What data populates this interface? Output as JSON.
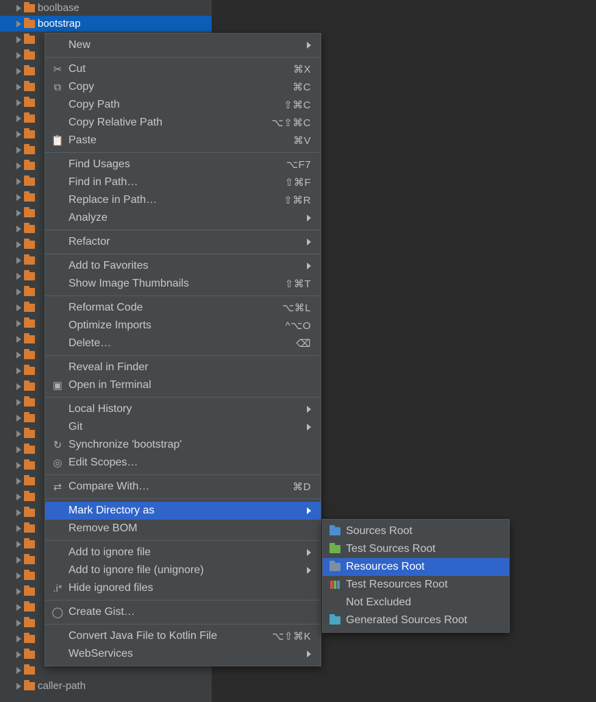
{
  "tree": {
    "items": [
      {
        "label": "boolbase",
        "selected": false
      },
      {
        "label": "bootstrap",
        "selected": true
      },
      {
        "label": "",
        "selected": false
      },
      {
        "label": "",
        "selected": false
      },
      {
        "label": "",
        "selected": false
      },
      {
        "label": "",
        "selected": false
      },
      {
        "label": "",
        "selected": false
      },
      {
        "label": "",
        "selected": false
      },
      {
        "label": "",
        "selected": false
      },
      {
        "label": "",
        "selected": false
      },
      {
        "label": "",
        "selected": false
      },
      {
        "label": "",
        "selected": false
      },
      {
        "label": "",
        "selected": false
      },
      {
        "label": "",
        "selected": false
      },
      {
        "label": "",
        "selected": false
      },
      {
        "label": "",
        "selected": false
      },
      {
        "label": "",
        "selected": false
      },
      {
        "label": "",
        "selected": false
      },
      {
        "label": "",
        "selected": false
      },
      {
        "label": "",
        "selected": false
      },
      {
        "label": "",
        "selected": false
      },
      {
        "label": "",
        "selected": false
      },
      {
        "label": "",
        "selected": false
      },
      {
        "label": "",
        "selected": false
      },
      {
        "label": "",
        "selected": false
      },
      {
        "label": "",
        "selected": false
      },
      {
        "label": "",
        "selected": false
      },
      {
        "label": "",
        "selected": false
      },
      {
        "label": "",
        "selected": false
      },
      {
        "label": "",
        "selected": false
      },
      {
        "label": "",
        "selected": false
      },
      {
        "label": "",
        "selected": false
      },
      {
        "label": "",
        "selected": false
      },
      {
        "label": "",
        "selected": false
      },
      {
        "label": "",
        "selected": false
      },
      {
        "label": "",
        "selected": false
      },
      {
        "label": "",
        "selected": false
      },
      {
        "label": "",
        "selected": false
      },
      {
        "label": "",
        "selected": false
      },
      {
        "label": "",
        "selected": false
      },
      {
        "label": "",
        "selected": false
      },
      {
        "label": "",
        "selected": false
      },
      {
        "label": "",
        "selected": false
      },
      {
        "label": "caller-path",
        "selected": false
      }
    ]
  },
  "menu": {
    "items": [
      {
        "type": "item",
        "label": "New",
        "icon": "",
        "shortcut": "",
        "arrow": true
      },
      {
        "type": "sep"
      },
      {
        "type": "item",
        "label": "Cut",
        "icon": "scissors-icon",
        "glyph": "✂",
        "shortcut": "⌘X"
      },
      {
        "type": "item",
        "label": "Copy",
        "icon": "copy-icon",
        "glyph": "⧉",
        "shortcut": "⌘C"
      },
      {
        "type": "item",
        "label": "Copy Path",
        "icon": "",
        "shortcut": "⇧⌘C"
      },
      {
        "type": "item",
        "label": "Copy Relative Path",
        "icon": "",
        "shortcut": "⌥⇧⌘C"
      },
      {
        "type": "item",
        "label": "Paste",
        "icon": "paste-icon",
        "glyph": "📋",
        "shortcut": "⌘V"
      },
      {
        "type": "sep"
      },
      {
        "type": "item",
        "label": "Find Usages",
        "icon": "",
        "shortcut": "⌥F7"
      },
      {
        "type": "item",
        "label": "Find in Path…",
        "icon": "",
        "shortcut": "⇧⌘F"
      },
      {
        "type": "item",
        "label": "Replace in Path…",
        "icon": "",
        "shortcut": "⇧⌘R"
      },
      {
        "type": "item",
        "label": "Analyze",
        "icon": "",
        "arrow": true
      },
      {
        "type": "sep"
      },
      {
        "type": "item",
        "label": "Refactor",
        "icon": "",
        "arrow": true
      },
      {
        "type": "sep"
      },
      {
        "type": "item",
        "label": "Add to Favorites",
        "icon": "",
        "arrow": true
      },
      {
        "type": "item",
        "label": "Show Image Thumbnails",
        "icon": "",
        "shortcut": "⇧⌘T"
      },
      {
        "type": "sep"
      },
      {
        "type": "item",
        "label": "Reformat Code",
        "icon": "",
        "shortcut": "⌥⌘L"
      },
      {
        "type": "item",
        "label": "Optimize Imports",
        "icon": "",
        "shortcut": "^⌥O"
      },
      {
        "type": "item",
        "label": "Delete…",
        "icon": "",
        "shortcut": "⌫"
      },
      {
        "type": "sep"
      },
      {
        "type": "item",
        "label": "Reveal in Finder",
        "icon": ""
      },
      {
        "type": "item",
        "label": "Open in Terminal",
        "icon": "terminal-icon",
        "glyph": "▣"
      },
      {
        "type": "sep"
      },
      {
        "type": "item",
        "label": "Local History",
        "icon": "",
        "arrow": true
      },
      {
        "type": "item",
        "label": "Git",
        "icon": "",
        "arrow": true
      },
      {
        "type": "item",
        "label": "Synchronize 'bootstrap'",
        "icon": "sync-icon",
        "glyph": "↻"
      },
      {
        "type": "item",
        "label": "Edit Scopes…",
        "icon": "scope-icon",
        "glyph": "◎"
      },
      {
        "type": "sep"
      },
      {
        "type": "item",
        "label": "Compare With…",
        "icon": "compare-icon",
        "glyph": "⇄",
        "shortcut": "⌘D"
      },
      {
        "type": "sep"
      },
      {
        "type": "item",
        "label": "Mark Directory as",
        "icon": "",
        "arrow": true,
        "selected": true
      },
      {
        "type": "item",
        "label": "Remove BOM",
        "icon": ""
      },
      {
        "type": "sep"
      },
      {
        "type": "item",
        "label": "Add to ignore file",
        "icon": "",
        "arrow": true
      },
      {
        "type": "item",
        "label": "Add to ignore file (unignore)",
        "icon": "",
        "arrow": true
      },
      {
        "type": "item",
        "label": "Hide ignored files",
        "icon": "hide-icon",
        "glyph": ".i*"
      },
      {
        "type": "sep"
      },
      {
        "type": "item",
        "label": "Create Gist…",
        "icon": "github-icon",
        "glyph": "◯"
      },
      {
        "type": "sep"
      },
      {
        "type": "item",
        "label": "Convert Java File to Kotlin File",
        "icon": "",
        "shortcut": "⌥⇧⌘K"
      },
      {
        "type": "item",
        "label": "WebServices",
        "icon": "",
        "arrow": true
      }
    ]
  },
  "submenu": {
    "items": [
      {
        "label": "Sources Root",
        "color": "#4a8fcb"
      },
      {
        "label": "Test Sources Root",
        "color": "#6fb04e"
      },
      {
        "label": "Resources Root",
        "color": "#7d8fa3",
        "selected": true
      },
      {
        "label": "Test Resources Root",
        "color": "#000000",
        "multi": true
      },
      {
        "label": "Not Excluded",
        "color": ""
      },
      {
        "label": "Generated Sources Root",
        "color": "#4aa6c2"
      }
    ]
  }
}
